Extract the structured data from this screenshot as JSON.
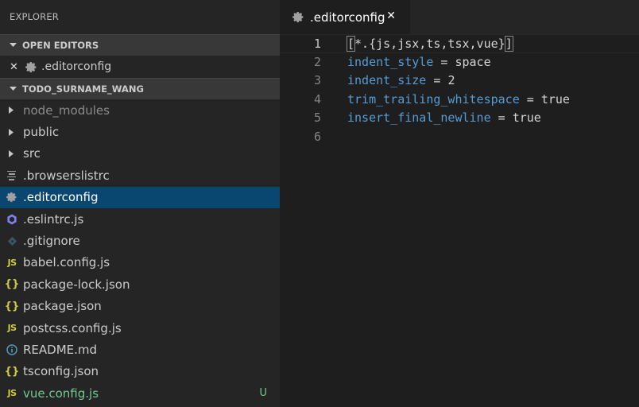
{
  "sidebar": {
    "title": "EXPLORER",
    "open_editors_header": "OPEN EDITORS",
    "open_editor_item": {
      "close": "✕",
      "label": ".editorconfig"
    },
    "project_header": "TODO_SURNAME_WANG",
    "tree": [
      {
        "label": "node_modules",
        "kind": "folder",
        "icon": "chevron-right-icon"
      },
      {
        "label": "public",
        "kind": "folder",
        "icon": "chevron-right-icon"
      },
      {
        "label": "src",
        "kind": "folder",
        "icon": "chevron-right-icon"
      },
      {
        "label": ".browserslistrc",
        "kind": "file",
        "icon": "lines-icon"
      },
      {
        "label": ".editorconfig",
        "kind": "file",
        "icon": "gear-icon",
        "selected": true
      },
      {
        "label": ".eslintrc.js",
        "kind": "file",
        "icon": "eslint-icon"
      },
      {
        "label": ".gitignore",
        "kind": "file",
        "icon": "git-icon"
      },
      {
        "label": "babel.config.js",
        "kind": "file",
        "icon": "js-icon",
        "icon_text": "JS"
      },
      {
        "label": "package-lock.json",
        "kind": "file",
        "icon": "json-icon",
        "icon_text": "{}"
      },
      {
        "label": "package.json",
        "kind": "file",
        "icon": "json-icon",
        "icon_text": "{}"
      },
      {
        "label": "postcss.config.js",
        "kind": "file",
        "icon": "js-icon",
        "icon_text": "JS"
      },
      {
        "label": "README.md",
        "kind": "file",
        "icon": "info-icon"
      },
      {
        "label": "tsconfig.json",
        "kind": "file",
        "icon": "json-icon",
        "icon_text": "{}"
      },
      {
        "label": "vue.config.js",
        "kind": "file",
        "icon": "js-icon",
        "icon_text": "JS",
        "badge": "U"
      }
    ]
  },
  "editor": {
    "tab": {
      "label": ".editorconfig",
      "close": "✕"
    },
    "lines": [
      {
        "num": "1",
        "section_open": "[",
        "section": "*.{js,jsx,ts,tsx,vue}",
        "section_close": "]"
      },
      {
        "num": "2",
        "key": "indent_style",
        "op": " = ",
        "value": "space"
      },
      {
        "num": "3",
        "key": "indent_size",
        "op": " = ",
        "value": "2"
      },
      {
        "num": "4",
        "key": "trim_trailing_whitespace",
        "op": " = ",
        "value": "true"
      },
      {
        "num": "5",
        "key": "insert_final_newline",
        "op": " = ",
        "value": "true"
      },
      {
        "num": "6"
      }
    ]
  },
  "colors": {
    "sidebar_bg": "#252526",
    "editor_bg": "#1e1e1e",
    "selection": "#094771",
    "key_blue": "#569cd6",
    "git_added": "#73c991",
    "js_yellow": "#cbcb41"
  }
}
